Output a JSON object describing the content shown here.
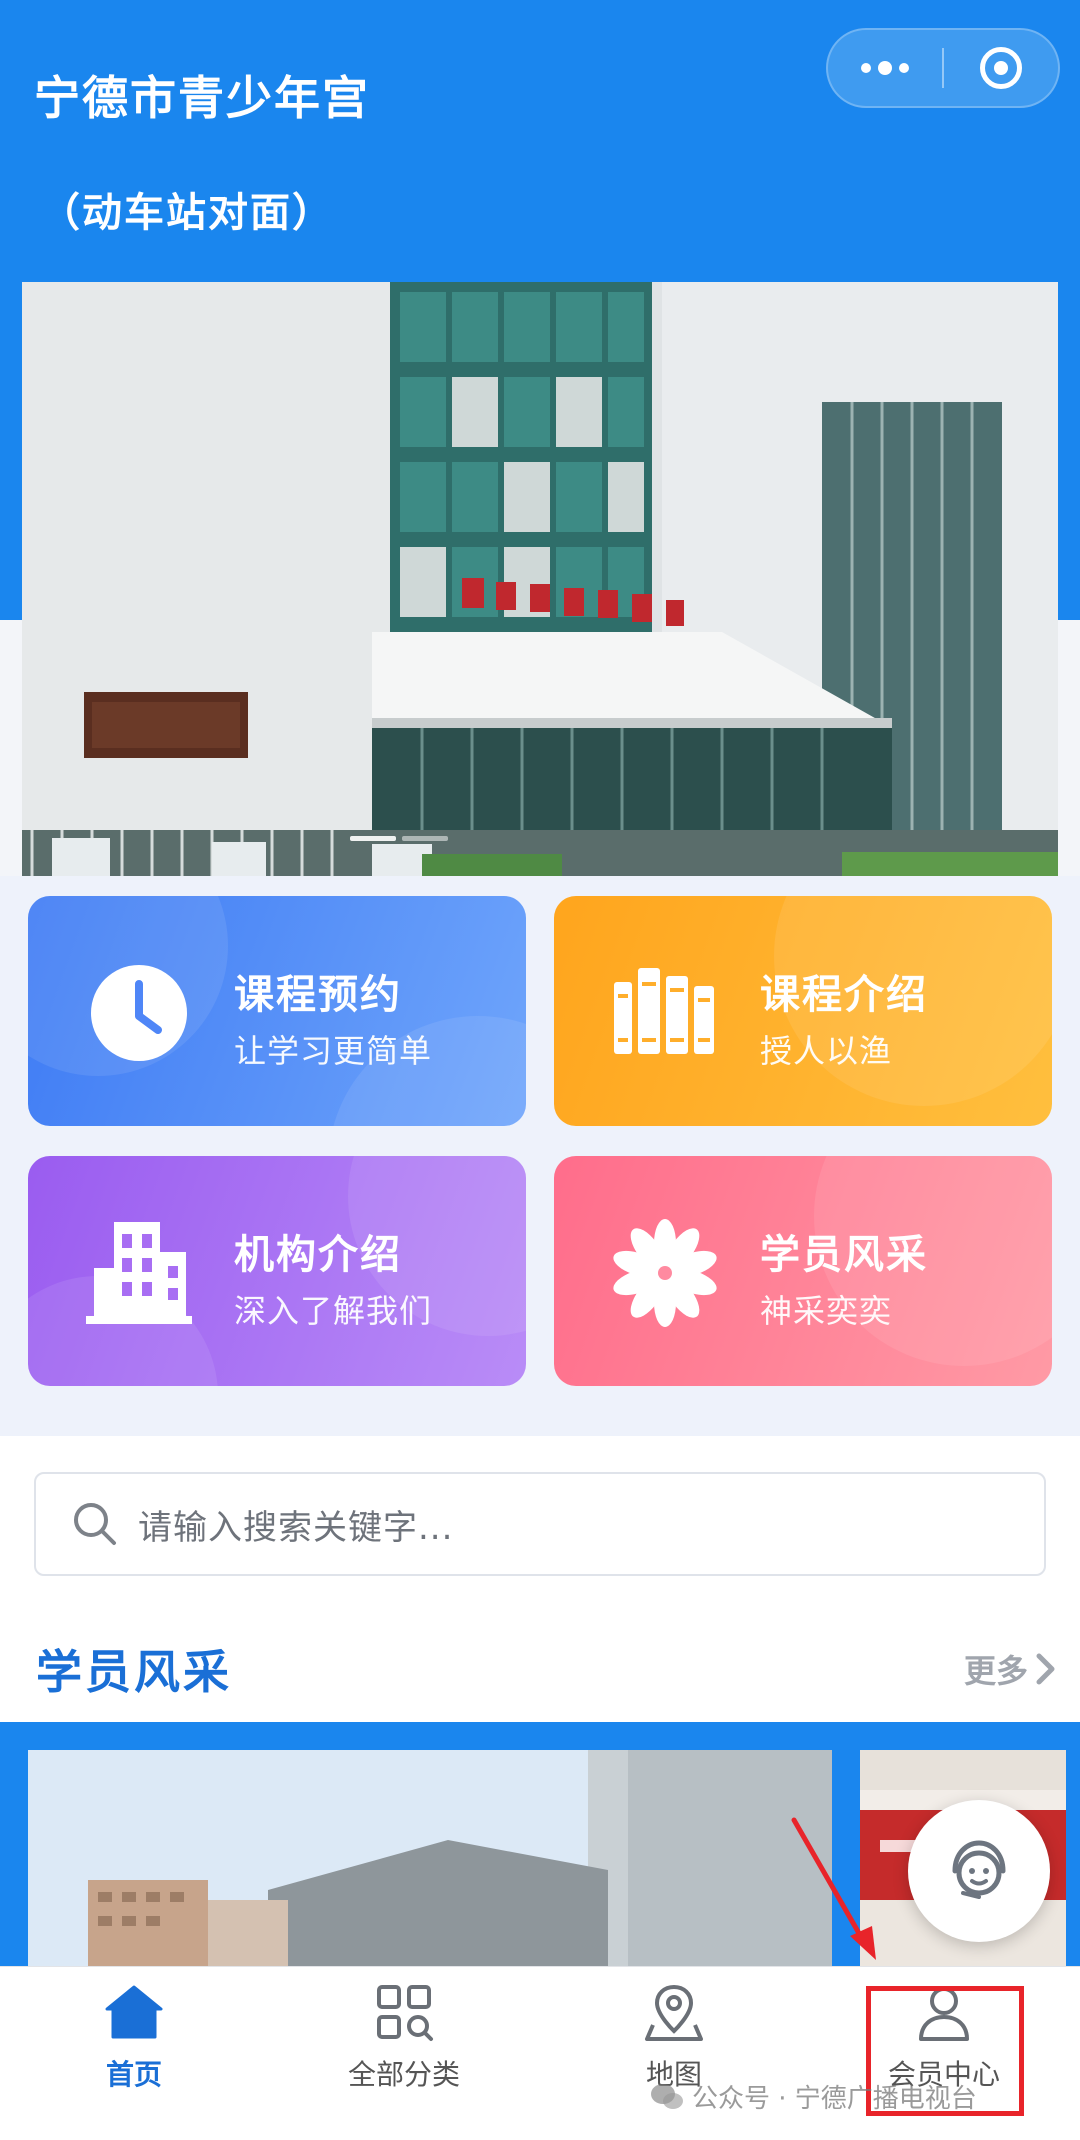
{
  "header": {
    "title": "宁德市青少年宫",
    "subtitle": "（动车站对面）"
  },
  "capsule": {
    "more_icon": "more-dots-icon",
    "close_icon": "target-close-icon"
  },
  "cards": [
    {
      "title": "课程预约",
      "subtitle": "让学习更简单",
      "icon": "clock-icon",
      "color": "#4f86f7"
    },
    {
      "title": "课程介绍",
      "subtitle": "授人以渔",
      "icon": "books-icon",
      "color": "#ffae2b"
    },
    {
      "title": "机构介绍",
      "subtitle": "深入了解我们",
      "icon": "building-icon",
      "color": "#a86ef3"
    },
    {
      "title": "学员风采",
      "subtitle": "神采奕奕",
      "icon": "flower-icon",
      "color": "#ff7d95"
    }
  ],
  "search": {
    "placeholder": "请输入搜索关键字..."
  },
  "section": {
    "title": "学员风采",
    "more": "更多"
  },
  "tabbar": [
    {
      "label": "首页",
      "icon": "home-icon",
      "active": true
    },
    {
      "label": "全部分类",
      "icon": "category-grid-icon"
    },
    {
      "label": "地图",
      "icon": "map-pin-icon"
    },
    {
      "label": "会员中心",
      "icon": "user-icon"
    }
  ],
  "watermark": {
    "text": "公众号 · 宁德广播电视台"
  },
  "colors": {
    "primary": "#1a86ee",
    "accent_red": "#e8242a"
  }
}
